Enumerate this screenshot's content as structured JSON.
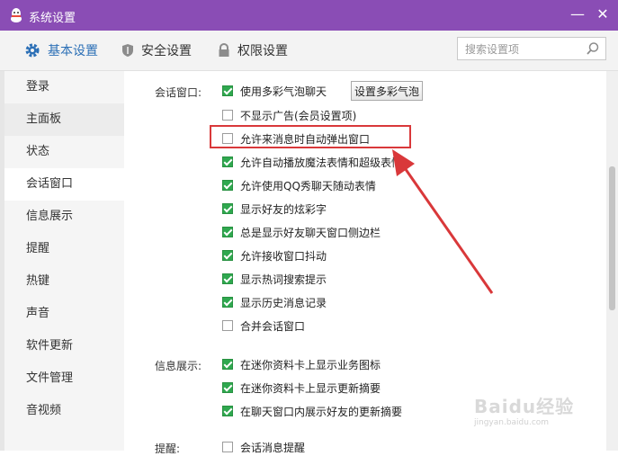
{
  "window": {
    "title": "系统设置",
    "minimize_glyph": "—",
    "close_glyph": "✕",
    "logo_icon": "qq-penguin-icon"
  },
  "tabs": [
    {
      "label": "基本设置",
      "icon": "gear-icon",
      "active": true
    },
    {
      "label": "安全设置",
      "icon": "shield-icon",
      "active": false
    },
    {
      "label": "权限设置",
      "icon": "lock-icon",
      "active": false
    }
  ],
  "search": {
    "placeholder": "搜索设置项",
    "value": "",
    "icon": "search-icon"
  },
  "sidebar": {
    "items": [
      {
        "label": "登录"
      },
      {
        "label": "主面板"
      },
      {
        "label": "状态"
      },
      {
        "label": "会话窗口",
        "active": true
      },
      {
        "label": "信息展示"
      },
      {
        "label": "提醒"
      },
      {
        "label": "热键"
      },
      {
        "label": "声音"
      },
      {
        "label": "软件更新"
      },
      {
        "label": "文件管理"
      },
      {
        "label": "音视频"
      }
    ]
  },
  "content": {
    "session": {
      "label": "会话窗口:",
      "bubble_button": "设置多彩气泡",
      "options": [
        {
          "label": "使用多彩气泡聊天",
          "checked": true
        },
        {
          "label": "不显示广告(会员设置项)",
          "checked": false
        },
        {
          "label": "允许来消息时自动弹出窗口",
          "checked": false
        },
        {
          "label": "允许自动播放魔法表情和超级表情",
          "checked": true
        },
        {
          "label": "允许使用QQ秀聊天随动表情",
          "checked": true
        },
        {
          "label": "显示好友的炫彩字",
          "checked": true
        },
        {
          "label": "总是显示好友聊天窗口侧边栏",
          "checked": true
        },
        {
          "label": "允许接收窗口抖动",
          "checked": true
        },
        {
          "label": "显示热词搜索提示",
          "checked": true
        },
        {
          "label": "显示历史消息记录",
          "checked": true
        },
        {
          "label": "合并会话窗口",
          "checked": false
        }
      ]
    },
    "info": {
      "label": "信息展示:",
      "options": [
        {
          "label": "在迷你资料卡上显示业务图标",
          "checked": true
        },
        {
          "label": "在迷你资料卡上显示更新摘要",
          "checked": true
        },
        {
          "label": "在聊天窗口内展示好友的更新摘要",
          "checked": true
        }
      ]
    },
    "remind": {
      "label": "提醒:",
      "options": [
        {
          "label": "会话消息提醒",
          "checked": false
        }
      ]
    }
  },
  "colors": {
    "titlebar": "#8a4db5",
    "accent": "#2b6fb6",
    "checkbox_on": "#2fa84f",
    "annotation": "#d9383a"
  },
  "watermark": {
    "text": "Baidu经验",
    "sub": "jingyan.baidu.com"
  }
}
